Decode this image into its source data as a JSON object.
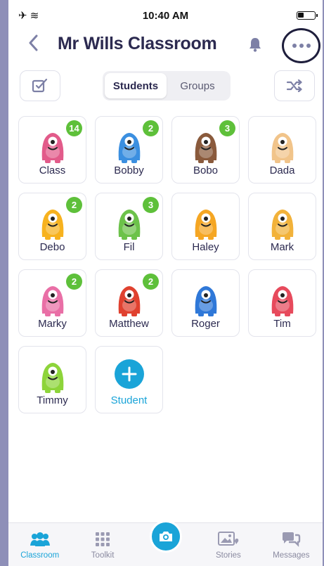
{
  "status_bar": {
    "time": "10:40 AM"
  },
  "header": {
    "title": "Mr Wills Classroom"
  },
  "toolbar": {
    "tabs": [
      {
        "label": "Students",
        "active": true
      },
      {
        "label": "Groups",
        "active": false
      }
    ]
  },
  "students": [
    {
      "name": "Class",
      "points": "14",
      "color": "#e25b8a"
    },
    {
      "name": "Bobby",
      "points": "2",
      "color": "#3b8fe0"
    },
    {
      "name": "Bobo",
      "points": "3",
      "color": "#8a5a3c"
    },
    {
      "name": "Dada",
      "points": null,
      "color": "#f1c48a"
    },
    {
      "name": "Debo",
      "points": "2",
      "color": "#f7b21e"
    },
    {
      "name": "Fil",
      "points": "3",
      "color": "#6cc24a"
    },
    {
      "name": "Haley",
      "points": null,
      "color": "#f5a623"
    },
    {
      "name": "Mark",
      "points": null,
      "color": "#f2b23a"
    },
    {
      "name": "Marky",
      "points": "2",
      "color": "#e96fa6"
    },
    {
      "name": "Matthew",
      "points": "2",
      "color": "#e0412f"
    },
    {
      "name": "Roger",
      "points": null,
      "color": "#2f78d8"
    },
    {
      "name": "Tim",
      "points": null,
      "color": "#e74a5c"
    },
    {
      "name": "Timmy",
      "points": null,
      "color": "#8dd43a"
    }
  ],
  "add_student": {
    "label": "Student"
  },
  "bottom_nav": [
    {
      "label": "Classroom",
      "icon": "classroom-icon",
      "active": true
    },
    {
      "label": "Toolkit",
      "icon": "toolkit-icon",
      "active": false
    },
    {
      "label": "",
      "icon": "camera-icon",
      "active": false
    },
    {
      "label": "Stories",
      "icon": "stories-icon",
      "active": false
    },
    {
      "label": "Messages",
      "icon": "messages-icon",
      "active": false
    }
  ],
  "colors": {
    "accent": "#1aa4d8",
    "badge": "#5ec03a",
    "title": "#2c2a50"
  }
}
